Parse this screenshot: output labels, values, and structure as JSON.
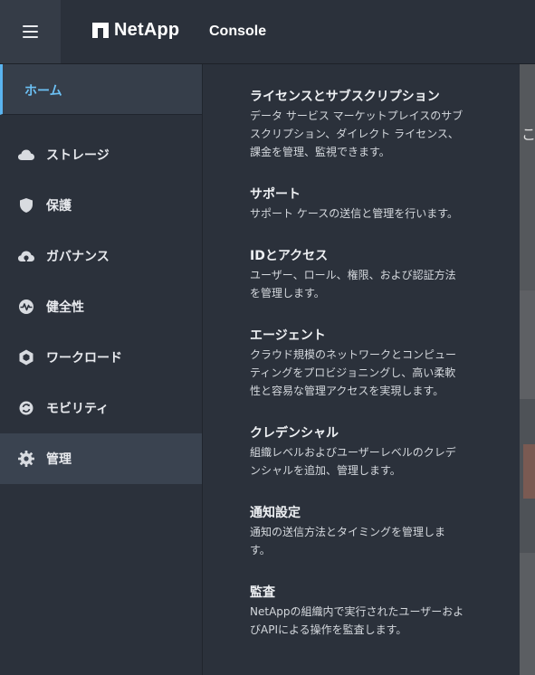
{
  "header": {
    "brand": "NetApp",
    "product": "Console"
  },
  "sidebar": {
    "home_label": "ホーム",
    "items": [
      {
        "label": "ストレージ",
        "icon": "cloud-icon"
      },
      {
        "label": "保護",
        "icon": "shield-icon"
      },
      {
        "label": "ガバナンス",
        "icon": "governance-icon"
      },
      {
        "label": "健全性",
        "icon": "health-icon"
      },
      {
        "label": "ワークロード",
        "icon": "workload-icon"
      },
      {
        "label": "モビリティ",
        "icon": "mobility-icon"
      },
      {
        "label": "管理",
        "icon": "gear-icon",
        "active": true
      }
    ]
  },
  "panel": {
    "entries": [
      {
        "title": "ライセンスとサブスクリプション",
        "desc": [
          "データ サービス マーケットプレイスのサブ",
          "スクリプション、ダイレクト ライセンス、",
          "課金を管理、監視できます。"
        ]
      },
      {
        "title": "サポート",
        "desc": [
          "サポート ケースの送信と管理を行います。"
        ]
      },
      {
        "title": "IDとアクセス",
        "desc": [
          "ユーザー、ロール、権限、および認証方法",
          "を管理します。"
        ]
      },
      {
        "title": "エージェント",
        "desc": [
          "クラウド規模のネットワークとコンピュー",
          "ティングをプロビジョニングし、高い柔軟",
          "性と容易な管理アクセスを実現します。"
        ]
      },
      {
        "title": "クレデンシャル",
        "desc": [
          "組織レベルおよびユーザーレベルのクレデ",
          "ンシャルを追加、管理します。"
        ]
      },
      {
        "title": "通知設定",
        "desc": [
          "通知の送信方法とタイミングを管理しま",
          "す。"
        ]
      },
      {
        "title": "監査",
        "desc": [
          "NetAppの組織内で実行されたユーザーおよ",
          "びAPIによる操作を監査します。"
        ]
      }
    ]
  },
  "background": {
    "partial_glyph": "こ"
  },
  "colors": {
    "accent": "#6cc1f5",
    "background": "#2b313b",
    "active_item": "#3a4350"
  }
}
